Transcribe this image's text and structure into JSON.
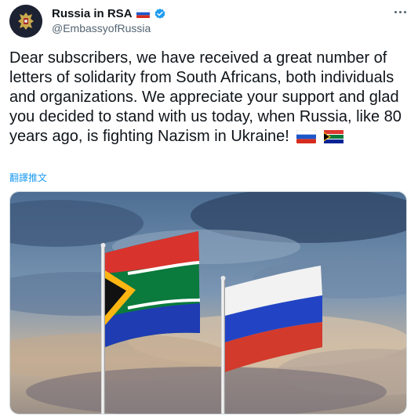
{
  "account": {
    "display_name": "Russia in RSA",
    "handle": "@EmbassyofRussia",
    "name_flag": "russia-flag-icon",
    "verified_badge": "verified-icon"
  },
  "tweet": {
    "text": "Dear subscribers, we have received a great number of letters of solidarity from South Africans, both individuals and organizations. We appreciate your support and glad you decided to stand with us today, when Russia, like 80 years ago, is fighting Nazism in Ukraine!",
    "trailing_flags": [
      "russia-flag-icon",
      "south-africa-flag-icon"
    ],
    "translate_label": "翻譯推文"
  },
  "media": {
    "image_subject": "flags-on-poles-photo"
  },
  "colors": {
    "link": "#1d9bf0",
    "text_primary": "#0f1419",
    "text_secondary": "#536471",
    "verified": "#1d9bf0"
  }
}
